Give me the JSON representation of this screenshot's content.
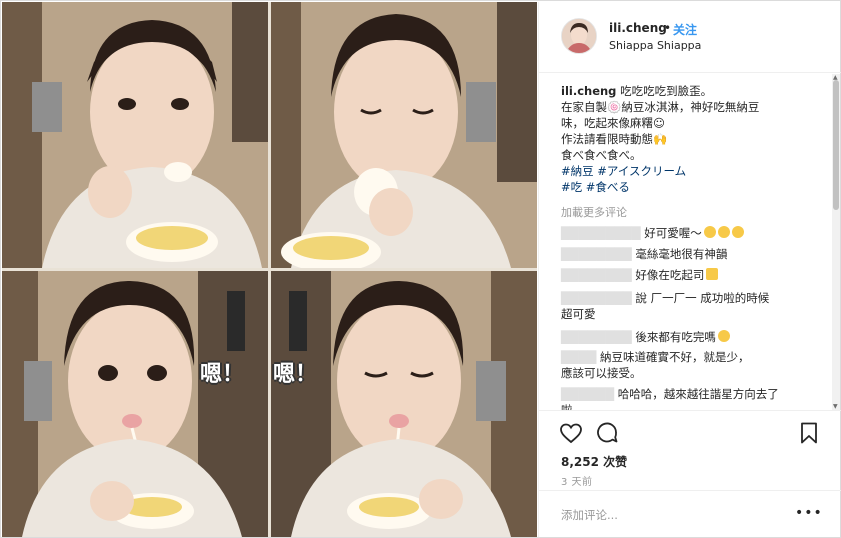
{
  "post": {
    "username": "ili.cheng",
    "separator": "•",
    "follow_label": "关注",
    "location": "Shiappa Shiappa"
  },
  "caption": {
    "user": "ili.cheng",
    "line1": " 吃吃吃吃到臉歪。",
    "line2": "在家自製🍥納豆冰淇淋，神好吃無納豆",
    "line3": "味，吃起來像麻糬☺",
    "line4": "作法請看限時動態🙌",
    "line5": "食べ食べ食べ。",
    "tags1": "#納豆 #アイスクリーム",
    "tags2": "#吃 #食べる"
  },
  "load_more_label": "加載更多评论",
  "comments": [
    {
      "user": "",
      "text": "好可愛喔～"
    },
    {
      "user": "",
      "text": "毫絲毫地很有神韻"
    },
    {
      "user": "",
      "text": "好像在吃起司"
    },
    {
      "user": "",
      "text": "說 厂一厂一 成功啦的時候"
    },
    {
      "user": "",
      "text": "超可愛"
    },
    {
      "user": "",
      "text": "後來都有吃完嗎"
    },
    {
      "user": "",
      "text": "納豆味道確實不好，就是少，"
    },
    {
      "user": "",
      "text": "應該可以接受。"
    },
    {
      "user": "",
      "text": "哈哈哈，越來越往諧星方向去了"
    },
    {
      "user": "",
      "text": "啦"
    }
  ],
  "likes": {
    "count": "8,252",
    "label": "次赞"
  },
  "time_ago": "3 天前",
  "add_comment": {
    "placeholder": "添加评论..."
  },
  "more_label": "•••",
  "overlay": {
    "left": "嗯！",
    "right": "嗯！"
  },
  "icons": {
    "like": "heart-icon",
    "comment": "comment-bubble-icon",
    "save": "bookmark-icon",
    "more": "more-options-icon"
  },
  "colors": {
    "follow_blue": "#3897f0",
    "hashtag": "#003569",
    "muted": "#999999",
    "text": "#262626"
  }
}
